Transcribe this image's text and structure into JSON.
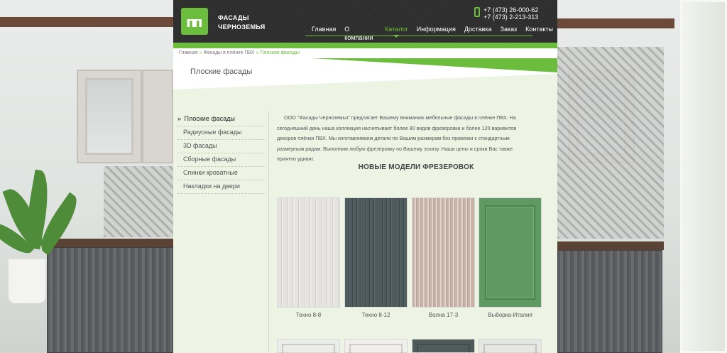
{
  "header": {
    "brand_line1": "Фасады",
    "brand_line2": "Черноземья",
    "phone1": "+7 (473) 26-000-62",
    "phone2": "+7 (473) 2-213-313",
    "nav": [
      {
        "label": "Главная"
      },
      {
        "label": "О компании"
      },
      {
        "label": "Каталог",
        "active": true
      },
      {
        "label": "Информация"
      },
      {
        "label": "Доставка"
      },
      {
        "label": "Заказ"
      },
      {
        "label": "Контакты"
      }
    ]
  },
  "breadcrumb": {
    "home": "Главная",
    "sep": "»",
    "parent": "Фасады в плёнке ПВХ",
    "current": "Плоские фасады"
  },
  "page_title": "Плоские фасады",
  "sidebar": {
    "active_marker": "»",
    "items": [
      {
        "label": "Плоские фасады",
        "active": true
      },
      {
        "label": "Радиусные фасады"
      },
      {
        "label": "3D фасады"
      },
      {
        "label": "Сборные фасады"
      },
      {
        "label": "Спинки кроватные"
      },
      {
        "label": "Накладки на двери"
      }
    ]
  },
  "intro": "ООО \"Фасады Черноземья\" предлагает Вашему вниманию мебельные фасады в плёнке ПВХ. На сегодняшний день наша коллекция насчитывает более 80 видов фрезеровки и более 120 вариантов декоров плёнки ПВХ. Мы изготавливаем детали по Вашим размерам без привязки к стандартным размерным рядам. Выполним любую фрезеровку по Вашему эскизу. Наши цены и сроки Вас также приятно удивят.",
  "section_title": "НОВЫЕ МОДЕЛИ ФРЕЗЕРОВОК",
  "products": [
    {
      "name": "Техно 8-8",
      "color": "#e4e3df"
    },
    {
      "name": "Техно 8-12",
      "color": "#4f5c5e"
    },
    {
      "name": "Волна 17-3",
      "color": "#c7b3a8"
    },
    {
      "name": "Выборка-Италия",
      "color": "#5f9a62"
    }
  ],
  "colors": {
    "accent": "#6cbd3e",
    "header_bg": "#2e2e2e",
    "content_bg": "#edf4e4"
  }
}
